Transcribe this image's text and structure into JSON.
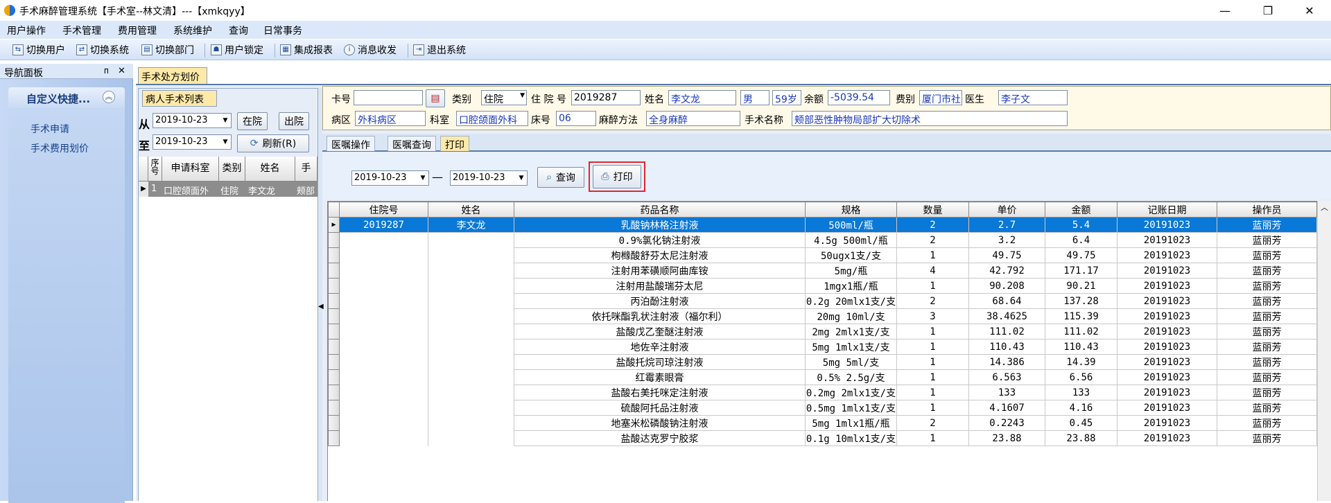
{
  "window": {
    "title": "手术麻醉管理系统【手术室--林文清】---【xmkqyy】",
    "controls": {
      "minimize": "—",
      "maximize": "❐",
      "close": "✕"
    }
  },
  "menu": [
    "用户操作",
    "手术管理",
    "费用管理",
    "系统维护",
    "查询",
    "日常事务"
  ],
  "toolbar": [
    {
      "label": "切换用户",
      "icon": "switch-user-icon"
    },
    {
      "label": "切换系统",
      "icon": "switch-system-icon"
    },
    {
      "label": "切换部门",
      "icon": "switch-department-icon"
    },
    {
      "label": "用户锁定",
      "icon": "lock-user-icon"
    },
    {
      "label": "集成报表",
      "icon": "report-icon"
    },
    {
      "label": "消息收发",
      "icon": "message-icon"
    },
    {
      "label": "退出系统",
      "icon": "exit-icon"
    }
  ],
  "nav_panel": {
    "title": "导航面板",
    "pin": "ᴨ",
    "close": "✕",
    "quick_title": "自定义快捷...",
    "collapse": "︽",
    "links": [
      "手术申请",
      "手术费用划价"
    ]
  },
  "doc_tab": "手术处方划价",
  "patient_list": {
    "tab": "病人手术列表",
    "from_label": "从",
    "to_label": "至",
    "from_date": "2019-10-23",
    "to_date": "2019-10-23",
    "in_hospital": "在院",
    "discharged": "出院",
    "refresh": "刷新(R)",
    "columns": [
      "序号",
      "申请科室",
      "类别",
      "姓名",
      "手"
    ],
    "rows": [
      [
        "1",
        "口腔颌面外",
        "住院",
        "李文龙",
        "颊部"
      ]
    ]
  },
  "patient_info": {
    "card_label": "卡号",
    "card_value": "",
    "type_label": "类别",
    "type_value": "住院",
    "admission_label": "住 院 号",
    "admission_value": "2019287",
    "name_label": "姓名",
    "name_value": "李文龙",
    "gender_value": "男",
    "age_value": "59岁",
    "balance_label": "余额",
    "balance_value": "-5039.54",
    "fee_label": "费别",
    "fee_value": "厦门市社",
    "doctor_label": "医生",
    "doctor_value": "李子文",
    "ward_label": "病区",
    "ward_value": "外科病区",
    "dept_label": "科室",
    "dept_value": "口腔颌面外科",
    "bed_label": "床号",
    "bed_value": "06",
    "anes_label": "麻醉方法",
    "anes_value": "全身麻醉",
    "surgery_label": "手术名称",
    "surgery_value": "颊部恶性肿物局部扩大切除术"
  },
  "sub_tabs": [
    {
      "label": "医嘱操作",
      "active": false
    },
    {
      "label": "医嘱查询",
      "active": false
    },
    {
      "label": "打印",
      "active": true
    }
  ],
  "query_bar": {
    "from_date": "2019-10-23",
    "dash": "—",
    "to_date": "2019-10-23",
    "query_button": "查询",
    "print_button": "打印"
  },
  "grid": {
    "columns": [
      "住院号",
      "姓名",
      "药品名称",
      "规格",
      "数量",
      "单价",
      "金额",
      "记账日期",
      "操作员"
    ],
    "rows": [
      [
        "2019287",
        "李文龙",
        "乳酸钠林格注射液",
        "500ml/瓶",
        "2",
        "2.7",
        "5.4",
        "20191023",
        "蓝丽芳"
      ],
      [
        "",
        "",
        "0.9%氯化钠注射液",
        "4.5g 500ml/瓶",
        "2",
        "3.2",
        "6.4",
        "20191023",
        "蓝丽芳"
      ],
      [
        "",
        "",
        "枸橼酸舒芬太尼注射液",
        "50ugx1支/支",
        "1",
        "49.75",
        "49.75",
        "20191023",
        "蓝丽芳"
      ],
      [
        "",
        "",
        "注射用苯磺顺阿曲库铵",
        "5mg/瓶",
        "4",
        "42.792",
        "171.17",
        "20191023",
        "蓝丽芳"
      ],
      [
        "",
        "",
        "注射用盐酸瑞芬太尼",
        "1mgx1瓶/瓶",
        "1",
        "90.208",
        "90.21",
        "20191023",
        "蓝丽芳"
      ],
      [
        "",
        "",
        "丙泊酚注射液",
        "0.2g 20mlx1支/支",
        "2",
        "68.64",
        "137.28",
        "20191023",
        "蓝丽芳"
      ],
      [
        "",
        "",
        "依托咪酯乳状注射液（福尔利）",
        "20mg 10ml/支",
        "3",
        "38.4625",
        "115.39",
        "20191023",
        "蓝丽芳"
      ],
      [
        "",
        "",
        "盐酸戊乙奎醚注射液",
        "2mg 2mlx1支/支",
        "1",
        "111.02",
        "111.02",
        "20191023",
        "蓝丽芳"
      ],
      [
        "",
        "",
        "地佐辛注射液",
        "5mg 1mlx1支/支",
        "1",
        "110.43",
        "110.43",
        "20191023",
        "蓝丽芳"
      ],
      [
        "",
        "",
        "盐酸托烷司琼注射液",
        "5mg 5ml/支",
        "1",
        "14.386",
        "14.39",
        "20191023",
        "蓝丽芳"
      ],
      [
        "",
        "",
        "红霉素眼膏",
        "0.5% 2.5g/支",
        "1",
        "6.563",
        "6.56",
        "20191023",
        "蓝丽芳"
      ],
      [
        "",
        "",
        "盐酸右美托咪定注射液",
        "0.2mg 2mlx1支/支",
        "1",
        "133",
        "133",
        "20191023",
        "蓝丽芳"
      ],
      [
        "",
        "",
        "硫酸阿托品注射液",
        "0.5mg 1mlx1支/支",
        "1",
        "4.1607",
        "4.16",
        "20191023",
        "蓝丽芳"
      ],
      [
        "",
        "",
        "地塞米松磷酸钠注射液",
        "5mg 1mlx1瓶/瓶",
        "2",
        "0.2243",
        "0.45",
        "20191023",
        "蓝丽芳"
      ],
      [
        "",
        "",
        "盐酸达克罗宁胶浆",
        "0.1g 10mlx1支/支",
        "1",
        "23.88",
        "23.88",
        "20191023",
        "蓝丽芳"
      ]
    ]
  },
  "colors": {
    "selection": "#0a78d7",
    "highlight_box": "#e3262d",
    "tab_active": "#ffe9a8"
  }
}
